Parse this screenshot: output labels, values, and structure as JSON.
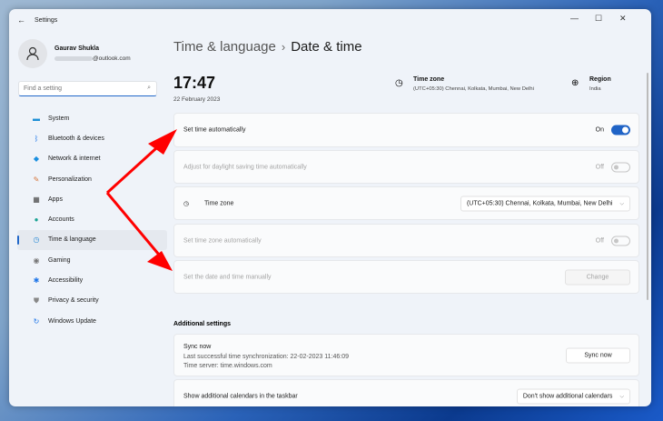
{
  "window": {
    "title": "Settings",
    "minimize": "—",
    "maximize": "☐",
    "close": "✕"
  },
  "profile": {
    "name": "Gaurav Shukla",
    "email_suffix": "@outlook.com"
  },
  "search": {
    "placeholder": "Find a setting"
  },
  "sidebar": {
    "items": [
      {
        "label": "System",
        "icon": "▬",
        "color": "#1d8fd6"
      },
      {
        "label": "Bluetooth & devices",
        "icon": "ᛒ",
        "color": "#1a73e8"
      },
      {
        "label": "Network & internet",
        "icon": "◆",
        "color": "#1a8fe0"
      },
      {
        "label": "Personalization",
        "icon": "✎",
        "color": "#d6763b"
      },
      {
        "label": "Apps",
        "icon": "▦",
        "color": "#444"
      },
      {
        "label": "Accounts",
        "icon": "●",
        "color": "#1aa394"
      },
      {
        "label": "Time & language",
        "icon": "◷",
        "color": "#2a8ad4"
      },
      {
        "label": "Gaming",
        "icon": "◉",
        "color": "#777"
      },
      {
        "label": "Accessibility",
        "icon": "✱",
        "color": "#1a73e8"
      },
      {
        "label": "Privacy & security",
        "icon": "⛊",
        "color": "#888"
      },
      {
        "label": "Windows Update",
        "icon": "↻",
        "color": "#1a73e8"
      }
    ],
    "selected": 6
  },
  "breadcrumb": {
    "parent": "Time & language",
    "separator": "›",
    "current": "Date & time"
  },
  "clock": {
    "time": "17:47",
    "date": "22 February 2023"
  },
  "header": {
    "timezone_label": "Time zone",
    "timezone_value": "(UTC+05:30) Chennai, Kolkata, Mumbai, New Delhi",
    "region_label": "Region",
    "region_value": "India"
  },
  "settings": {
    "set_time_auto": {
      "label": "Set time automatically",
      "state": "On"
    },
    "daylight": {
      "label": "Adjust for daylight saving time automatically",
      "state": "Off"
    },
    "time_zone": {
      "label": "Time zone",
      "value": "(UTC+05:30) Chennai, Kolkata, Mumbai, New Delhi"
    },
    "tz_auto": {
      "label": "Set time zone automatically",
      "state": "Off"
    },
    "manual": {
      "label": "Set the date and time manually",
      "button": "Change"
    }
  },
  "additional": {
    "heading": "Additional settings",
    "sync": {
      "title": "Sync now",
      "last": "Last successful time synchronization: 22-02-2023 11:46:09",
      "server": "Time server: time.windows.com",
      "button": "Sync now"
    },
    "calendars": {
      "label": "Show additional calendars in the taskbar",
      "value": "Don't show additional calendars"
    }
  },
  "colors": {
    "accent": "#1f63c6",
    "annotation": "#ff0000"
  }
}
